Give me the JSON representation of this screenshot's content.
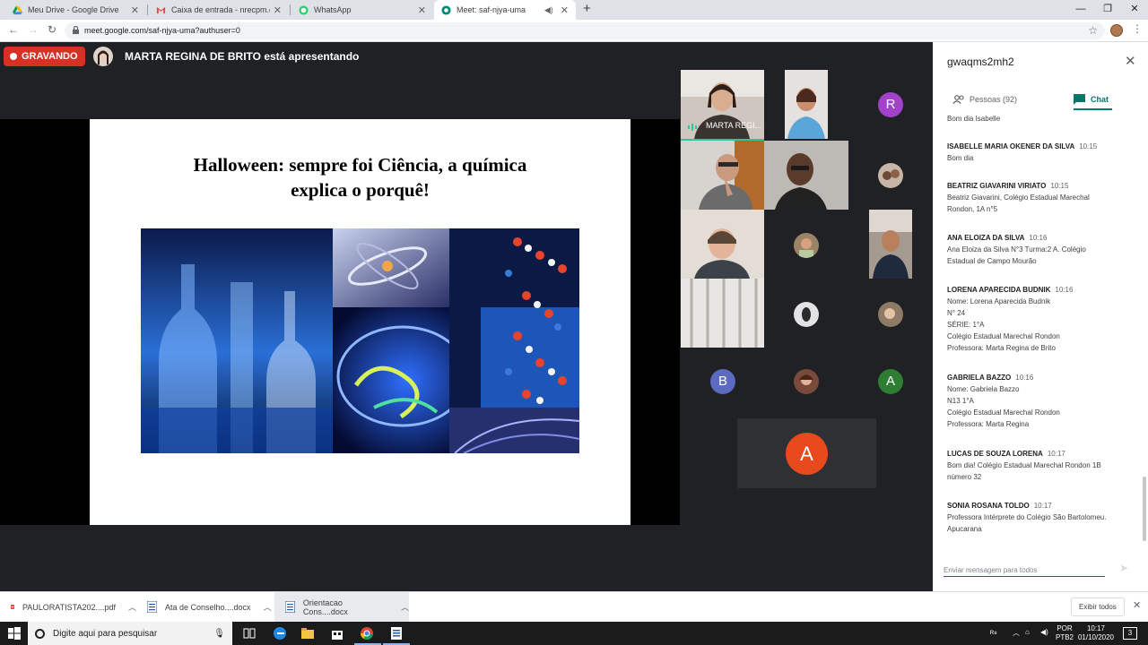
{
  "browser": {
    "tabs": [
      {
        "title": "Meu Drive - Google Drive",
        "icon": "google-drive-icon"
      },
      {
        "title": "Caixa de entrada - nrecpm.eja@g",
        "icon": "gmail-icon"
      },
      {
        "title": "WhatsApp",
        "icon": "whatsapp-icon"
      },
      {
        "title": "Meet: saf-njya-uma",
        "icon": "meet-icon",
        "active": true
      }
    ],
    "url": "meet.google.com/saf-njya-uma?authuser=0"
  },
  "meet": {
    "recording_label": "GRAVANDO",
    "presenter_text": "MARTA REGINA DE BRITO está apresentando",
    "slide_title_line1": "Halloween: sempre foi Ciência, a química",
    "slide_title_line2": "explica o porquê!",
    "tiles": {
      "marta_name": "MARTA REGI...",
      "letter_r": "R",
      "letter_b": "B",
      "letter_a1": "A",
      "letter_a_big": "A"
    }
  },
  "panel": {
    "meeting_code": "gwaqms2mh2",
    "people_tab": "Pessoas (92)",
    "chat_tab": "Chat",
    "messages": [
      {
        "sender": "",
        "time": "",
        "body": "Bom dia Isabelle"
      },
      {
        "sender": "ISABELLE MARIA OKENER DA SILVA",
        "time": "10:15",
        "body": "Bom dia"
      },
      {
        "sender": "BEATRIZ GIAVARINI VIRIATO",
        "time": "10:15",
        "body": "Beatriz Giavarini, Colégio Estadual Marechal\nRondon, 1A n°5"
      },
      {
        "sender": "ANA ELOIZA DA SILVA",
        "time": "10:16",
        "body": "Ana Eloiza da Silva N°3 Turma:2 A. Colégio\nEstadual de Campo Mourão"
      },
      {
        "sender": "LORENA APARECIDA BUDNIK",
        "time": "10:16",
        "body": "Nome: Lorena Aparecida Budnik\nN° 24\nSÉRIE: 1°A\nColégio Estadual Marechal Rondon\nProfessora: Marta Regina de Brito"
      },
      {
        "sender": "GABRIELA BAZZO",
        "time": "10:16",
        "body": "Nome: Gabriela Bazzo\nN13  1°A\nColégio Estadual Marechal Rondon\nProfessora: Marta Regina"
      },
      {
        "sender": "LUCAS DE SOUZA LORENA",
        "time": "10:17",
        "body": "Bom dia! Colégio Estadual Marechal Rondon 1B\nnúmero 32"
      },
      {
        "sender": "SONIA ROSANA TOLDO",
        "time": "10:17",
        "body": "Professora Intérprete do Colégio São Bartolomeu.\nApucarana"
      }
    ],
    "chat_placeholder": "Enviar mensagem para todos"
  },
  "downloads": {
    "items": [
      {
        "name": "PAULORATISTA202....pdf",
        "icon": "pdf-file-icon"
      },
      {
        "name": "Ata de Conselho....docx",
        "icon": "word-file-icon"
      },
      {
        "name": "Orientacao Cons....docx",
        "icon": "word-file-icon"
      }
    ],
    "show_all": "Exibir todos"
  },
  "taskbar": {
    "search_placeholder": "Digite aqui para pesquisar",
    "lang_top": "POR",
    "lang_bottom": "PTB2",
    "time": "10:17",
    "date": "01/10/2020",
    "notification_count": "3"
  },
  "colors": {
    "recording": "#d93025",
    "chat_accent": "#00796b",
    "avatar_r": "#a142c8",
    "avatar_b": "#5c6bc0",
    "avatar_a_green": "#2e7d32",
    "avatar_a_orange": "#e8491d"
  }
}
